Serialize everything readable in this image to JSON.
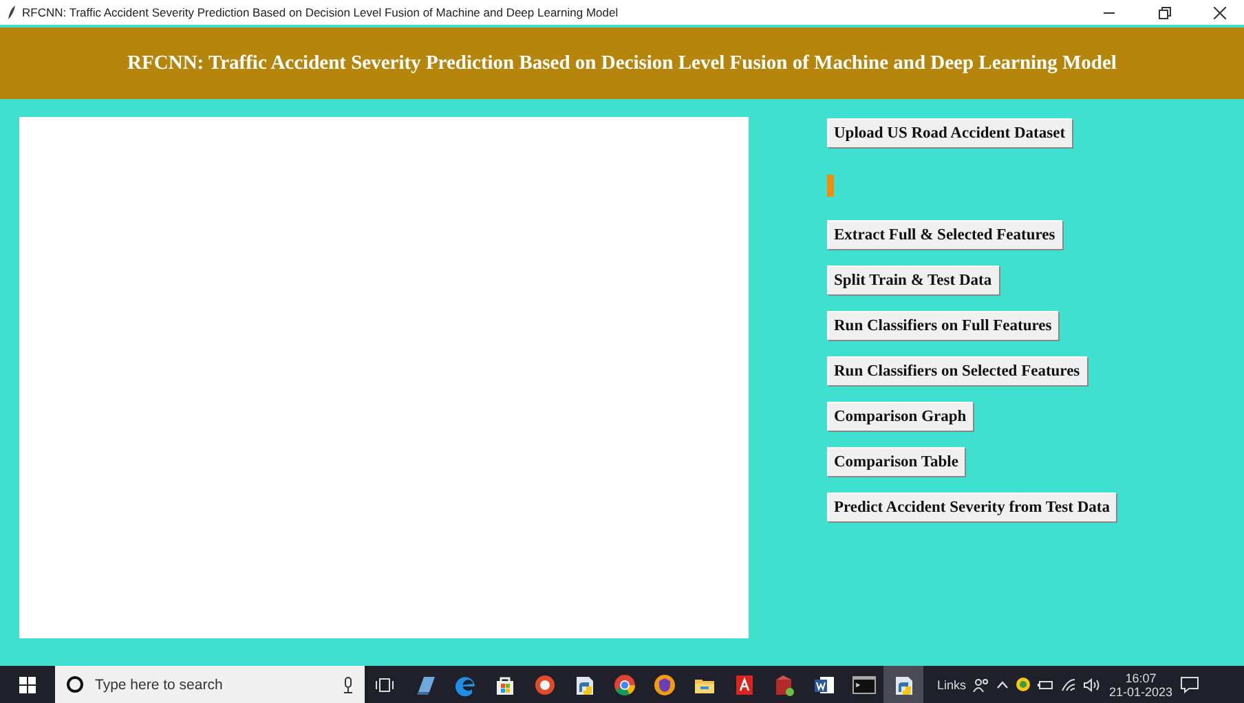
{
  "window": {
    "title": "RFCNN: Traffic Accident Severity Prediction Based on Decision Level Fusion of Machine and Deep Learning Model"
  },
  "header": {
    "title": "RFCNN: Traffic Accident Severity Prediction Based on Decision Level Fusion of Machine and Deep Learning Model"
  },
  "buttons": [
    {
      "label": "Upload US Road Accident Dataset"
    },
    {
      "label": "Extract Full & Selected Features"
    },
    {
      "label": "Split Train & Test Data"
    },
    {
      "label": "Run Classifiers on Full Features"
    },
    {
      "label": "Run Classifiers on Selected Features"
    },
    {
      "label": "Comparison Graph"
    },
    {
      "label": "Comparison Table"
    },
    {
      "label": "Predict Accident Severity from Test Data"
    }
  ],
  "taskbar": {
    "search": {
      "placeholder": "Type here to search"
    },
    "apps": [
      {
        "kind": "notes",
        "selected": false
      },
      {
        "kind": "edge",
        "selected": false
      },
      {
        "kind": "store",
        "selected": false
      },
      {
        "kind": "browser",
        "selected": false
      },
      {
        "kind": "python",
        "selected": false
      },
      {
        "kind": "chrome",
        "selected": false
      },
      {
        "kind": "shield",
        "selected": false
      },
      {
        "kind": "folder",
        "selected": false
      },
      {
        "kind": "pdf",
        "selected": false
      },
      {
        "kind": "installer",
        "selected": false
      },
      {
        "kind": "word",
        "selected": false
      },
      {
        "kind": "terminal",
        "selected": false
      },
      {
        "kind": "python",
        "selected": true
      }
    ],
    "links": "Links",
    "time": "16:07",
    "date": "21-01-2023"
  }
}
